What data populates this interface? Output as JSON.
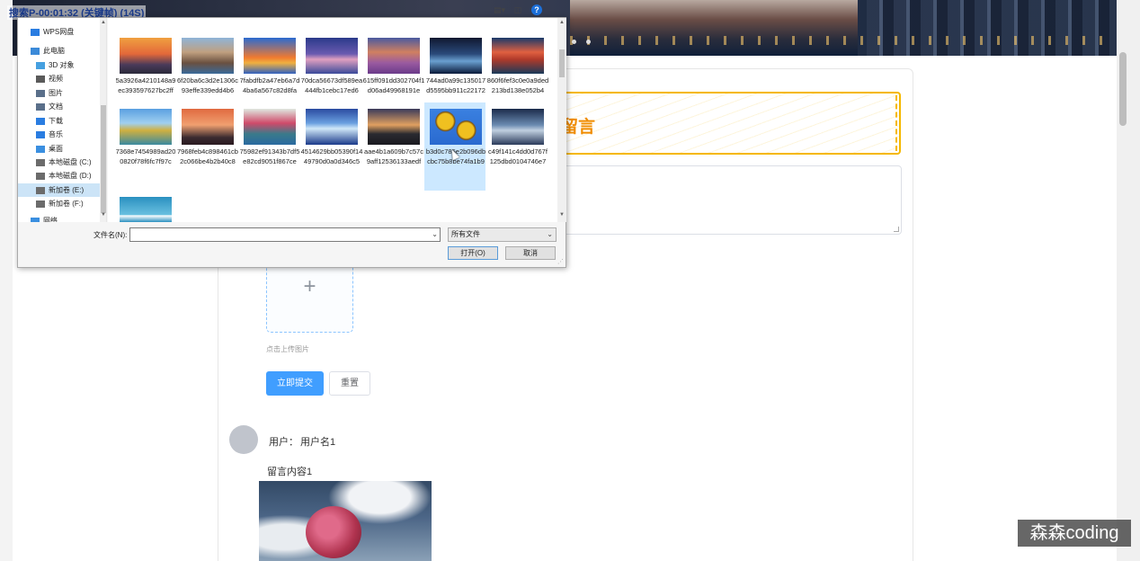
{
  "recording_caption": "搜索P-00:01:32 (关键帧) (14S)",
  "page": {
    "section_title": "留言",
    "upload_hint": "点击上传图片",
    "submit_label": "立即提交",
    "reset_label": "重置",
    "comment": {
      "user_label": "用户：",
      "user_name": "用户名1",
      "content": "留言内容1"
    }
  },
  "watermark": "森森coding",
  "file_dialog": {
    "nav_items": [
      {
        "label": "WPS网盘",
        "icon": "cloud-icon"
      },
      {
        "label": "此电脑",
        "icon": "computer-icon"
      },
      {
        "label": "3D 对象",
        "icon": "cube-icon"
      },
      {
        "label": "视频",
        "icon": "video-icon"
      },
      {
        "label": "图片",
        "icon": "picture-icon"
      },
      {
        "label": "文档",
        "icon": "document-icon"
      },
      {
        "label": "下载",
        "icon": "download-icon"
      },
      {
        "label": "音乐",
        "icon": "music-icon"
      },
      {
        "label": "桌面",
        "icon": "desktop-icon"
      },
      {
        "label": "本地磁盘 (C:)",
        "icon": "drive-icon"
      },
      {
        "label": "本地磁盘 (D:)",
        "icon": "drive-icon"
      },
      {
        "label": "新加卷 (E:)",
        "icon": "drive-icon",
        "selected": true
      },
      {
        "label": "新加卷 (F:)",
        "icon": "drive-icon"
      },
      {
        "label": "网络",
        "icon": "network-icon"
      }
    ],
    "files": [
      {
        "name": "5a3926a4210148a9ec393597627bc2ff"
      },
      {
        "name": "6f20ba6c3d2e1306c93effe339edd4b6"
      },
      {
        "name": "7fabdfb2a47eb6a7d4ba6a567c82d8fa"
      },
      {
        "name": "70dca56673df589ea444fb1cebc17ed6"
      },
      {
        "name": "615ff091dd302704f1d06ad49968191e"
      },
      {
        "name": "744ad0a99c135017d5595bb911c22172"
      },
      {
        "name": "860f6fef3c0e0a9ded213bd138e052b4"
      },
      {
        "name": "7368e7454989ad200820f78f6fc7f97c"
      },
      {
        "name": "7968feb4c898461cb2c066be4b2b40c8"
      },
      {
        "name": "75982ef91343b7df5e82cd9051f867ce"
      },
      {
        "name": "4514629bb05390f1449790d0a0d346c5"
      },
      {
        "name": "aae4b1a609b7c57c9aff12536133aedf"
      },
      {
        "name": "b3d0c785e2b096dbcbc75b8be74fa1b9",
        "selected": true
      },
      {
        "name": "c49f141c4dd0d767f125dbd0104746e7"
      },
      {
        "name": ""
      }
    ],
    "filename_label": "文件名(N):",
    "filename_value": "",
    "filetype_value": "所有文件",
    "open_label": "打开(O)",
    "cancel_label": "取消"
  }
}
